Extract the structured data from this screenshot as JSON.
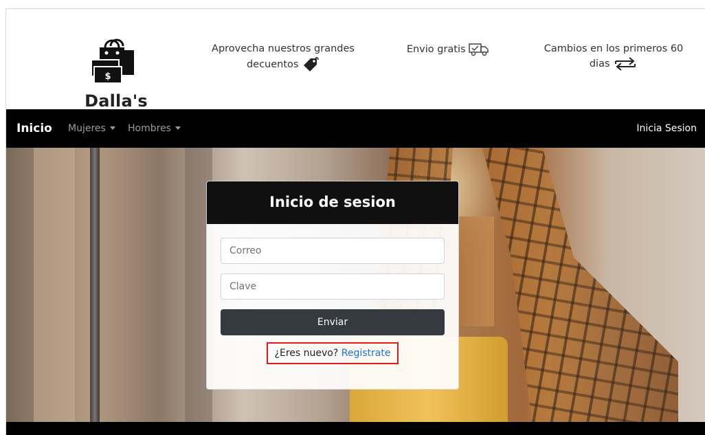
{
  "brand": {
    "name": "Dalla's Clothes",
    "logo_icon": "shopping-bags-money-icon"
  },
  "promos": [
    {
      "text": "Aprovecha nuestros grandes decuentos",
      "icon": "sale-tag-icon"
    },
    {
      "text": "Envio gratis",
      "icon": "delivery-truck-icon"
    },
    {
      "text": "Cambios en los primeros 60 dias",
      "icon": "exchange-arrows-icon"
    }
  ],
  "navbar": {
    "brand": "Inicio",
    "items": [
      {
        "label": "Mujeres"
      },
      {
        "label": "Hombres"
      }
    ],
    "login": "Inicia Sesion"
  },
  "login_card": {
    "title": "Inicio de sesion",
    "email_placeholder": "Correo",
    "password_placeholder": "Clave",
    "submit_label": "Enviar",
    "register_prompt": "¿Eres nuevo?",
    "register_link": "Registrate"
  },
  "colors": {
    "navbar_bg": "#000000",
    "card_header_bg": "#101010",
    "button_bg": "#343a40",
    "link": "#1a73e8",
    "highlight_border": "#e11a1a"
  }
}
